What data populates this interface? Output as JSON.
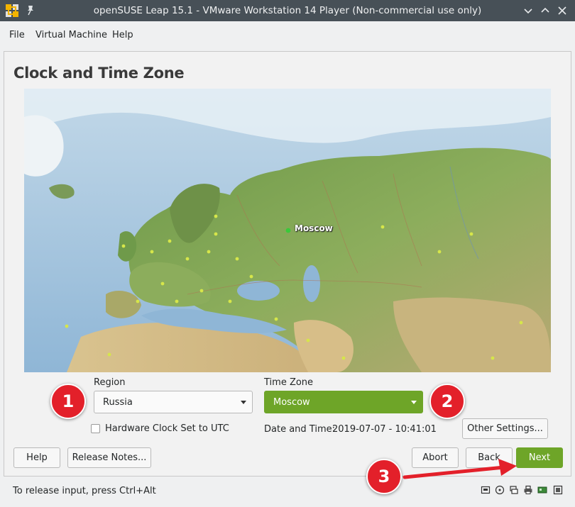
{
  "window": {
    "title": "openSUSE Leap 15.1 - VMware Workstation 14 Player (Non-commercial use only)",
    "app_icon": "vmware-icon",
    "pin_icon": "pin-icon",
    "minimize_icon": "chevron-down-icon",
    "maximize_icon": "chevron-up-icon",
    "close_icon": "close-icon"
  },
  "menu": {
    "file": "File",
    "virtual_machine": "Virtual Machine",
    "help": "Help"
  },
  "installer": {
    "heading": "Clock and Time Zone",
    "map_city_label": "Moscow",
    "region_label": "Region",
    "region_value": "Russia",
    "timezone_label": "Time Zone",
    "timezone_value": "Moscow",
    "hwclock_label": "Hardware Clock Set to UTC",
    "datetime_label": "Date and Time:",
    "datetime_value": "2019-07-07 - 10:41:01",
    "other_settings": "Other Settings...",
    "help_button": "Help",
    "release_notes_button": "Release Notes...",
    "abort_button": "Abort",
    "back_button": "Back",
    "next_button": "Next",
    "accent_color": "#6ea528"
  },
  "status": {
    "hint": "To release input, press Ctrl+Alt"
  },
  "annotations": {
    "badge1": "1",
    "badge2": "2",
    "badge3": "3",
    "color": "#e3202a"
  }
}
